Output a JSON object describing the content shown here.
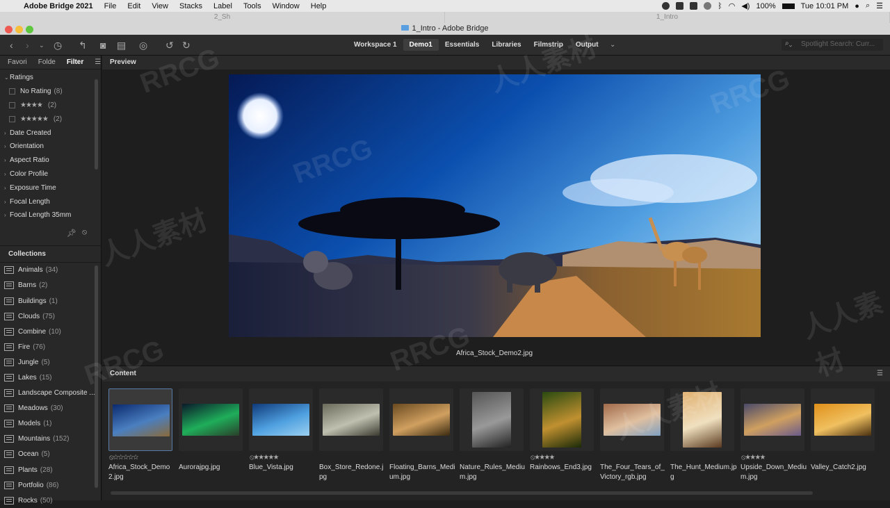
{
  "menubar": {
    "app_name": "Adobe Bridge 2021",
    "items": [
      "File",
      "Edit",
      "View",
      "Stacks",
      "Label",
      "Tools",
      "Window",
      "Help"
    ],
    "battery": "100%",
    "clock": "Tue 10:01 PM"
  },
  "window": {
    "tabs": [
      "2_Sh",
      "1_Intro"
    ],
    "title": "1_Intro - Adobe Bridge"
  },
  "toolbar": {
    "workspaces": [
      "Workspace 1",
      "Demo1",
      "Essentials",
      "Libraries",
      "Filmstrip",
      "Output"
    ],
    "active_workspace": "Demo1",
    "search_placeholder": "Spotlight Search: Curr..."
  },
  "left_panel": {
    "tabs": [
      "Favori",
      "Folde",
      "Filter"
    ],
    "active_tab": "Filter",
    "filter": {
      "ratings_label": "Ratings",
      "ratings": [
        {
          "label": "No Rating",
          "stars": "",
          "count": "(8)"
        },
        {
          "label": "",
          "stars": "★★★★",
          "count": "(2)"
        },
        {
          "label": "",
          "stars": "★★★★★",
          "count": "(2)"
        }
      ],
      "sections": [
        "Date Created",
        "Orientation",
        "Aspect Ratio",
        "Color Profile",
        "Exposure Time",
        "Focal Length",
        "Focal Length 35mm"
      ]
    },
    "collections_label": "Collections",
    "collections": [
      {
        "name": "Animals",
        "count": "(34)"
      },
      {
        "name": "Barns",
        "count": "(2)"
      },
      {
        "name": "Buildings",
        "count": "(1)"
      },
      {
        "name": "Clouds",
        "count": "(75)"
      },
      {
        "name": "Combine",
        "count": "(10)"
      },
      {
        "name": "Fire",
        "count": "(76)"
      },
      {
        "name": "Jungle",
        "count": "(5)"
      },
      {
        "name": "Lakes",
        "count": "(15)"
      },
      {
        "name": "Landscape Composite ...",
        "count": ""
      },
      {
        "name": "Meadows",
        "count": "(30)"
      },
      {
        "name": "Models",
        "count": "(1)"
      },
      {
        "name": "Mountains",
        "count": "(152)"
      },
      {
        "name": "Ocean",
        "count": "(5)"
      },
      {
        "name": "Plants",
        "count": "(28)"
      },
      {
        "name": "Portfolio",
        "count": "(86)"
      },
      {
        "name": "Rocks",
        "count": "(50)"
      }
    ]
  },
  "preview": {
    "header": "Preview",
    "caption": "Africa_Stock_Demo2.jpg"
  },
  "content": {
    "header": "Content",
    "items": [
      {
        "name": "Africa_Stock_Demo2.jpg",
        "rating": "⦸☆☆☆☆☆",
        "colors": [
          "#0b2a6e",
          "#4a7fc0",
          "#8a6a3a"
        ]
      },
      {
        "name": "Aurorajpg.jpg",
        "rating": "",
        "colors": [
          "#0a1a2a",
          "#1fae5a",
          "#2a3f2a"
        ]
      },
      {
        "name": "Blue_Vista.jpg",
        "rating": "⦸★★★★★",
        "colors": [
          "#0f3a7a",
          "#4fa0e0",
          "#9bd0f0"
        ]
      },
      {
        "name": "Box_Store_Redone.jpg",
        "rating": "",
        "colors": [
          "#6a6a5a",
          "#c0c0b0",
          "#3a3a30"
        ]
      },
      {
        "name": "Floating_Barns_Medium.jpg",
        "rating": "",
        "colors": [
          "#6a4a20",
          "#d0a060",
          "#3a2a10"
        ]
      },
      {
        "name": "Nature_Rules_Medium.jpg",
        "rating": "",
        "colors": [
          "#555",
          "#999",
          "#222"
        ]
      },
      {
        "name": "Rainbows_End3.jpg",
        "rating": "⦸★★★★",
        "colors": [
          "#2a4a10",
          "#c09030",
          "#1a2a08"
        ]
      },
      {
        "name": "The_Four_Tears_of_Victory_rgb.jpg",
        "rating": "",
        "colors": [
          "#a06a4a",
          "#e0c0a0",
          "#80a0c0"
        ]
      },
      {
        "name": "The_Hunt_Medium.jpg",
        "rating": "",
        "colors": [
          "#e0b070",
          "#f0e0c0",
          "#5a3a20"
        ]
      },
      {
        "name": "Upside_Down_Medium.jpg",
        "rating": "⦸★★★★",
        "colors": [
          "#4a4a6a",
          "#d0a060",
          "#6a5a8a"
        ]
      },
      {
        "name": "Valley_Catch2.jpg",
        "rating": "",
        "colors": [
          "#e0901a",
          "#f0c060",
          "#4a3010"
        ]
      }
    ]
  },
  "watermark": [
    "RRCG",
    "人人素材"
  ]
}
